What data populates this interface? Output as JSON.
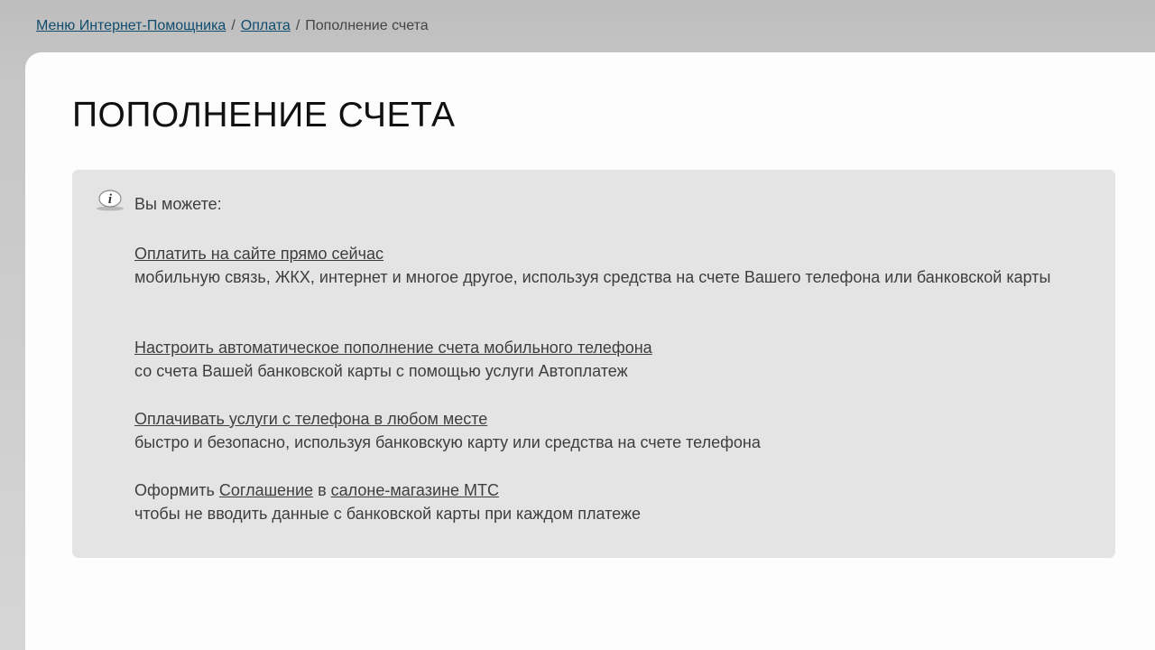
{
  "breadcrumb": {
    "menu": "Меню Интернет-Помощника",
    "payment": "Оплата",
    "current": "Пополнение счета",
    "separator": "/"
  },
  "page_title": "ПОПОЛНЕНИЕ СЧЕТА",
  "info": {
    "icon": "info-icon",
    "intro": "Вы можете:",
    "items": [
      {
        "link": "Оплатить на сайте прямо сейчас",
        "description": "мобильную связь, ЖКХ, интернет и многое другое, используя средства на счете Вашего телефона или банковской карты"
      },
      {
        "link": "Настроить автоматическое пополнение счета мобильного телефона",
        "description": "со счета Вашей банковской карты с помощью услуги Автоплатеж"
      },
      {
        "link": "Оплачивать услуги с телефона в любом месте",
        "description": "быстро и безопасно, используя банковскую карту или средства на счете телефона"
      }
    ],
    "agreement": {
      "prefix": "Оформить",
      "link1": "Соглашение",
      "middle": "в",
      "link2": "салоне-магазине МТС",
      "description": "чтобы не вводить данные с банковской карты при каждом платеже"
    }
  },
  "colors": {
    "link_breadcrumb": "#0f4c6e",
    "text": "#3e3e3e",
    "info_box_bg": "#e4e4e4"
  }
}
